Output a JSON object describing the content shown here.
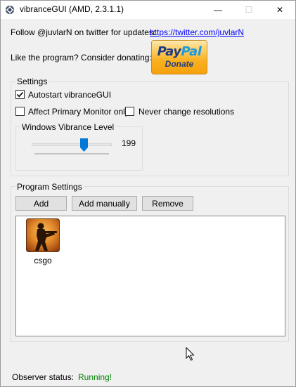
{
  "window": {
    "title": "vibranceGUI (AMD, 2.3.1.1)",
    "minimize_glyph": "—",
    "maximize_glyph": "☐",
    "close_glyph": "✕"
  },
  "header": {
    "follow_text": "Follow @juvlarN on twitter for updates:",
    "twitter_link": "https://twitter.com/juvlarN",
    "donate_text": "Like the program? Consider donating:",
    "paypal_pay": "Pay",
    "paypal_pal": "Pal",
    "paypal_donate": "Donate"
  },
  "settings": {
    "legend": "Settings",
    "autostart_label": "Autostart vibranceGUI",
    "autostart_checked": true,
    "affect_primary_label": "Affect Primary Monitor only",
    "affect_primary_checked": false,
    "never_change_label": "Never change resolutions",
    "never_change_checked": false,
    "vibrance": {
      "legend": "Windows Vibrance Level",
      "value": "199"
    }
  },
  "program_settings": {
    "legend": "Program Settings",
    "add_label": "Add",
    "add_manually_label": "Add manually",
    "remove_label": "Remove",
    "items": [
      {
        "label": "csgo",
        "icon": "csgo-icon"
      }
    ]
  },
  "status": {
    "label": "Observer status:",
    "value": "Running!",
    "value_color": "#008000"
  },
  "colors": {
    "link": "#0000ff",
    "paypal_gold": "#f9b11f",
    "paypal_blue": "#1f3b83",
    "slider_thumb": "#0078d7"
  }
}
